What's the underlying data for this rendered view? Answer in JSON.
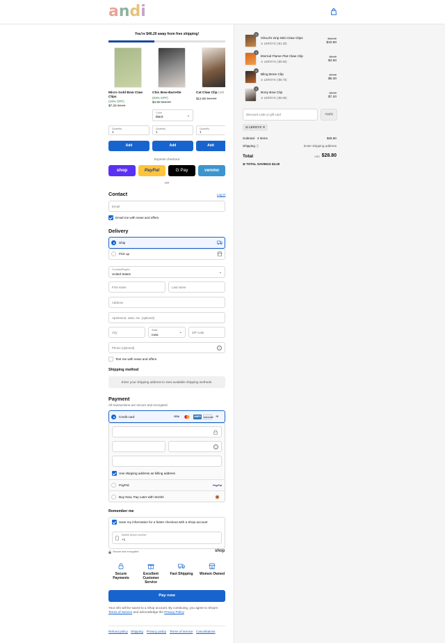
{
  "brand": {
    "letters": [
      "a",
      "n",
      "d",
      "i"
    ]
  },
  "free_shipping": {
    "message": "You're $46.20 away from free shipping!",
    "progress": 0.39
  },
  "upsell": [
    {
      "name": "Micro Gold Bow Claw Clips",
      "discount": "(16% OFF)",
      "price": "$7.20",
      "old_price": "$8.60",
      "qty_label": "Quantity",
      "qty": "1",
      "add": "Add"
    },
    {
      "name": "Chic Bow Barrette",
      "discount": "(63% OFF)",
      "price": "$4.50",
      "old_price": "$12.00",
      "color_label": "Color",
      "color_value": "Black",
      "qty_label": "Quantity",
      "qty": "1",
      "add": "Add"
    },
    {
      "name": "Cat Claw Clip",
      "name_suffix": "(oth",
      "price": "$12.60",
      "old_price": "$14.00",
      "qty_label": "Quantity",
      "qty": "1",
      "add": "Add"
    }
  ],
  "express": {
    "label": "Express checkout",
    "buttons": [
      "shop",
      "PayPal",
      "G Pay",
      "venmo"
    ],
    "or": "OR"
  },
  "contact": {
    "title": "Contact",
    "login": "Log in",
    "email_placeholder": "Email",
    "newsletter": "Email me with news and offers"
  },
  "delivery": {
    "title": "Delivery",
    "ship": "Ship",
    "pickup": "Pick up",
    "country_label": "Country/Region",
    "country": "United States",
    "first_name": "First name",
    "last_name": "Last name",
    "address": "Address",
    "apartment": "Apartment, suite, etc. (optional)",
    "city": "City",
    "state_label": "State",
    "state": "Iowa",
    "zip": "ZIP code",
    "phone": "Phone (optional)",
    "sms": "Text me with news and offers"
  },
  "shipping_method": {
    "title": "Shipping method",
    "note": "Enter your shipping address to view available shipping methods."
  },
  "payment": {
    "title": "Payment",
    "subtitle": "All transactions are secure and encrypted.",
    "credit_card": "Credit card",
    "card_logos": [
      "VISA",
      "MC",
      "AMEX",
      "DISCOVER",
      "+5"
    ],
    "billing": "Use shipping address as billing address",
    "paypal": "PayPal",
    "sezzle": "Buy Now, Pay Later with Sezzle"
  },
  "remember": {
    "title": "Remember me",
    "save": "Save my information for a faster checkout with a Shop account",
    "mobile_label": "Mobile phone number",
    "mobile_value": "+1",
    "secure": "Secure and encrypted",
    "shop": "shop"
  },
  "trust": [
    {
      "label": "Secure Payments"
    },
    {
      "label": "Excellent Customer Service"
    },
    {
      "label": "Fast Shipping"
    },
    {
      "label": "Women Owned"
    }
  ],
  "pay_now": "Pay now",
  "legal": {
    "text": "Your info will be saved to a Shop account. By continuing, you agree to Shop's",
    "terms": "Terms of Service",
    "and": "and acknowledge the",
    "privacy": "Privacy Policy",
    "end": "."
  },
  "footer": [
    "Refund policy",
    "Shipping",
    "Privacy policy",
    "Terms of service",
    "Cancellations"
  ],
  "cart": {
    "items": [
      {
        "qty": "1",
        "name": "Ghoul's Grip Mini Claw Clips",
        "tag": "LEROYS (-$1.20)",
        "old": "$12.00",
        "price": "$10.80"
      },
      {
        "qty": "1",
        "name": "Eternal Flame Flat Claw Clip",
        "tag": "LEROYS (-$0.50)",
        "old": "$5.00",
        "price": "$4.50"
      },
      {
        "qty": "1",
        "name": "Bling Bone Clip",
        "tag": "LEROYS (-$0.70)",
        "old": "$7.00",
        "price": "$6.30"
      },
      {
        "qty": "1",
        "name": "Bony Bow Clip",
        "tag": "LEROYS (-$0.80)",
        "old": "$8.00",
        "price": "$7.20"
      }
    ],
    "discount_placeholder": "Discount code or gift card",
    "apply": "Apply",
    "code": "LEROYS",
    "subtotal_label": "Subtotal · 4 items",
    "subtotal": "$28.80",
    "shipping_label": "Shipping",
    "shipping_value": "Enter shipping address",
    "total_label": "Total",
    "currency": "USD",
    "total": "$28.80",
    "savings_label": "TOTAL SAVINGS",
    "savings": "$3.20"
  },
  "colors": {
    "accent": "#1764cf",
    "progress": "#1a47a5",
    "shop": "#5a31f4",
    "paypal": "#ffc439",
    "venmo": "#3d95ce"
  }
}
